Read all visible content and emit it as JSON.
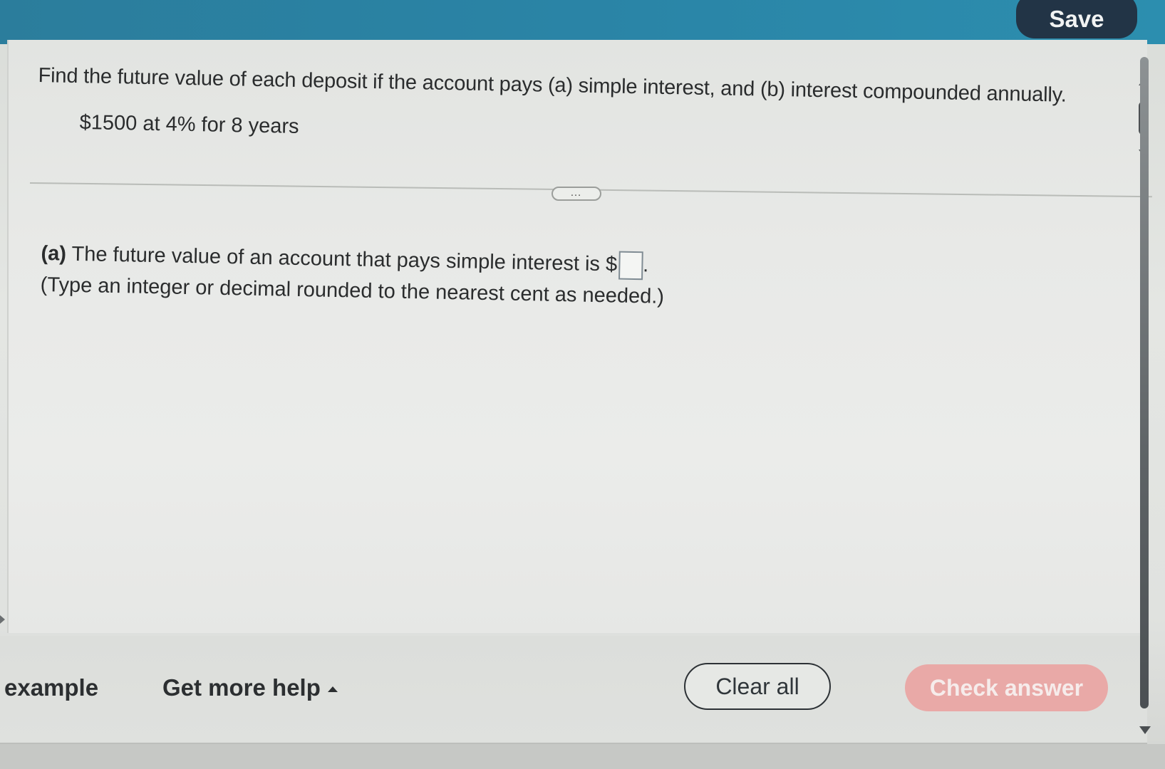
{
  "header": {
    "save_label": "Save"
  },
  "question": {
    "title": "Find the future value of each deposit if the account pays (a) simple interest, and (b) interest compounded annually.",
    "given": "$1500 at 4% for 8 years",
    "more_label": "…"
  },
  "part_a": {
    "label": "(a)",
    "text_before": "The future value of an account that pays simple interest is $",
    "text_after": ".",
    "answer_value": "",
    "hint": "(Type an integer or decimal rounded to the nearest cent as needed.)"
  },
  "footer": {
    "example_label": "example",
    "help_label": "Get more help",
    "clear_label": "Clear all",
    "check_label": "Check answer"
  },
  "colors": {
    "topbar": "#2a84a6",
    "save_button": "#223446",
    "check_button": "#e9a9a7"
  }
}
